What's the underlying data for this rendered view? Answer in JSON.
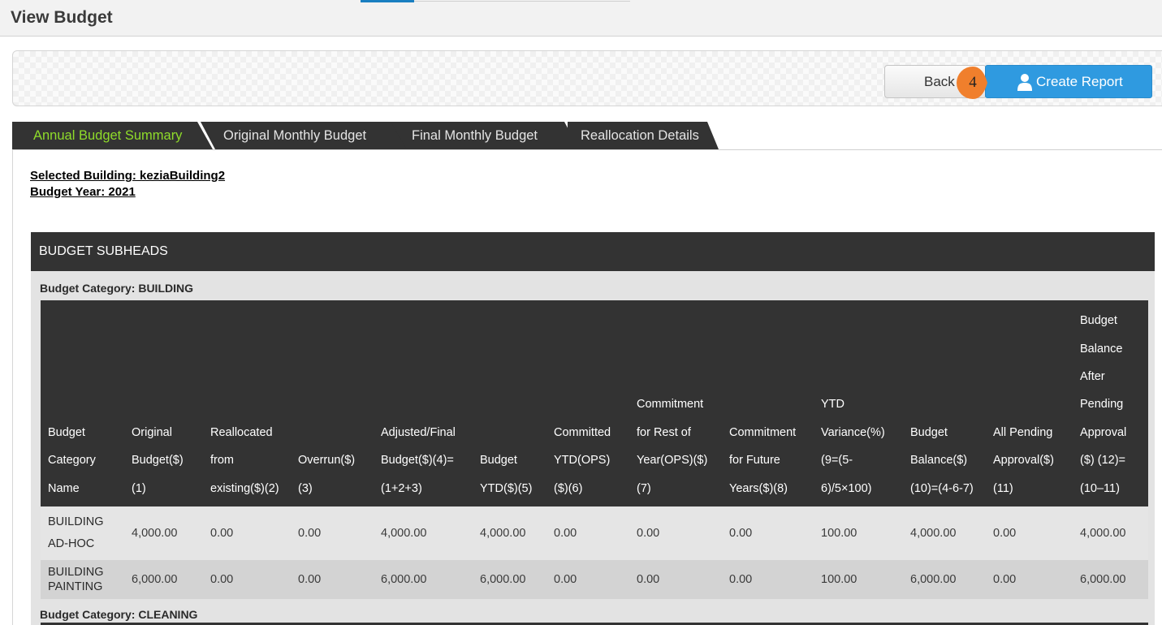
{
  "page": {
    "title": "View Budget"
  },
  "toolbar": {
    "back_label": "Back",
    "create_report_label": "Create Report",
    "step_number": "4"
  },
  "tabs": [
    {
      "label": "Annual Budget Summary",
      "active": true
    },
    {
      "label": "Original Monthly Budget",
      "active": false
    },
    {
      "label": "Final Monthly Budget",
      "active": false
    },
    {
      "label": "Reallocation Details",
      "active": false
    }
  ],
  "info": {
    "building": "Selected Building: keziaBuilding2",
    "year": "Budget Year: 2021"
  },
  "panel": {
    "title": "BUDGET SUBHEADS"
  },
  "categories": [
    {
      "label": "Budget Category: BUILDING",
      "columns": [
        [
          "Budget",
          "Category",
          "Name"
        ],
        [
          "Original",
          "Budget($)",
          "(1)"
        ],
        [
          "Reallocated",
          "from",
          "existing($)(2)"
        ],
        [
          "Overrun($)",
          "(3)"
        ],
        [
          "Adjusted/Final",
          "Budget($)(4)=",
          "(1+2+3)"
        ],
        [
          "Budget",
          "YTD($)(5)"
        ],
        [
          "Committed",
          "YTD(OPS)",
          "($)(6)"
        ],
        [
          "Commitment",
          "for Rest of",
          "Year(OPS)($)",
          "(7)"
        ],
        [
          "Commitment",
          "for Future",
          "Years($)(8)"
        ],
        [
          "YTD",
          "Variance(%)",
          "(9=(5-",
          "6)/5×100)"
        ],
        [
          "Budget",
          "Balance($)",
          "(10)=(4-6-7)"
        ],
        [
          "All Pending",
          "Approval($)",
          "(11)"
        ],
        [
          "Budget",
          "Balance",
          "After",
          "Pending",
          "Approval",
          "($) (12)=",
          "(10–11)"
        ]
      ],
      "rows": [
        {
          "name": [
            "BUILDING",
            "AD-HOC"
          ],
          "values": [
            "4,000.00",
            "0.00",
            "0.00",
            "4,000.00",
            "4,000.00",
            "0.00",
            "0.00",
            "0.00",
            "100.00",
            "4,000.00",
            "0.00",
            "4,000.00"
          ]
        },
        {
          "name": [
            "BUILDING",
            "PAINTING"
          ],
          "values": [
            "6,000.00",
            "0.00",
            "0.00",
            "6,000.00",
            "6,000.00",
            "0.00",
            "0.00",
            "0.00",
            "100.00",
            "6,000.00",
            "0.00",
            "6,000.00"
          ]
        }
      ]
    },
    {
      "label": "Budget Category: CLEANING"
    }
  ],
  "icons": {
    "create_report": "user-icon",
    "step_pointer": "step-badge-arrow"
  },
  "colors": {
    "primary": "#2f9ae0",
    "dark_header": "#333333",
    "active_tab_text": "#8fdc2a",
    "step_badge": "#f07f2c"
  }
}
